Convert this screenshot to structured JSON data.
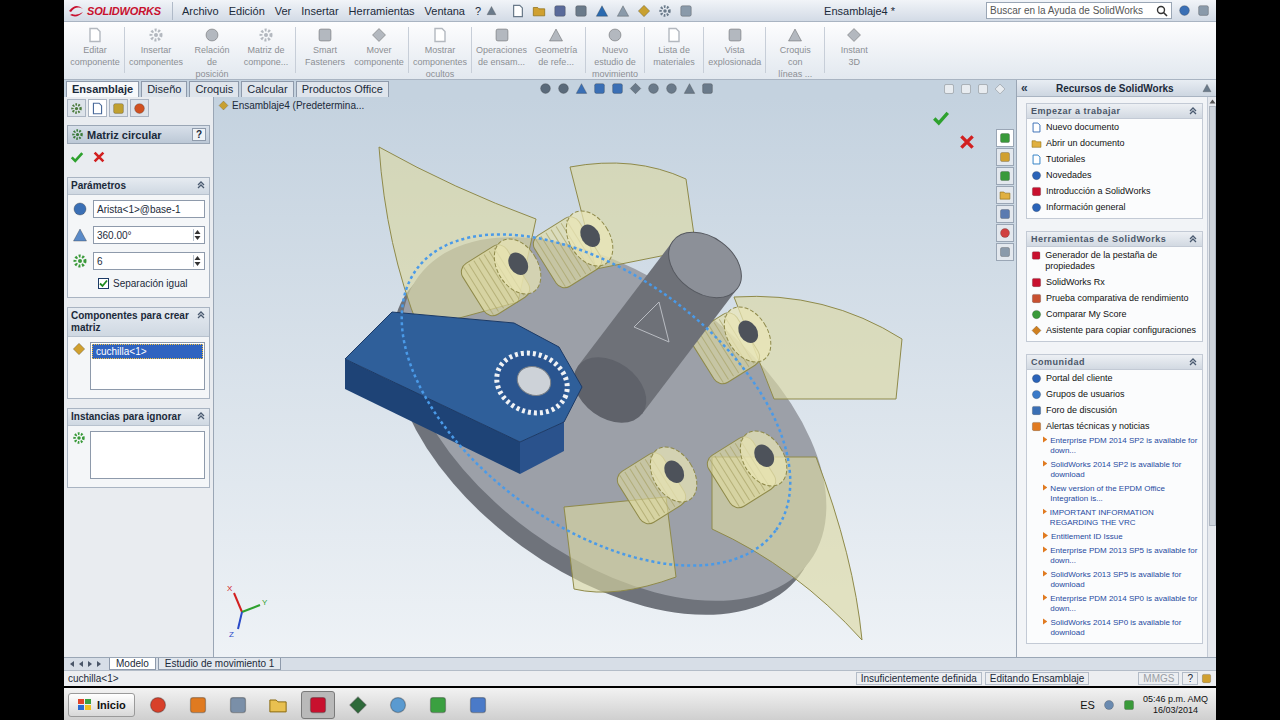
{
  "app": {
    "logo_text": "SOLIDWORKS",
    "title": "Ensamblaje4 *"
  },
  "menu": [
    "Archivo",
    "Edición",
    "Ver",
    "Insertar",
    "Herramientas",
    "Ventana",
    "?"
  ],
  "search": {
    "placeholder": "Buscar en la Ayuda de SolidWorks"
  },
  "ribbon": [
    {
      "lines": [
        "Editar",
        "componente"
      ],
      "disabled": true
    },
    {
      "lines": [
        "Insertar",
        "componentes"
      ],
      "disabled": true
    },
    {
      "lines": [
        "Relación",
        "de",
        "posición"
      ],
      "disabled": true
    },
    {
      "lines": [
        "Matriz de",
        "compone..."
      ],
      "disabled": true
    },
    {
      "lines": [
        "Smart",
        "Fasteners"
      ],
      "disabled": true
    },
    {
      "lines": [
        "Mover",
        "componente"
      ],
      "disabled": true
    },
    {
      "lines": [
        "Mostrar",
        "componentes",
        "ocultos"
      ],
      "disabled": true
    },
    {
      "lines": [
        "Operaciones",
        "de ensam..."
      ],
      "disabled": true
    },
    {
      "lines": [
        "Geometría",
        "de refe..."
      ],
      "disabled": true
    },
    {
      "lines": [
        "Nuevo",
        "estudio de",
        "movimiento"
      ],
      "disabled": true
    },
    {
      "lines": [
        "Lista de",
        "materiales"
      ],
      "disabled": true
    },
    {
      "lines": [
        "Vista",
        "explosionada"
      ],
      "disabled": true
    },
    {
      "lines": [
        "Croquis",
        "con",
        "líneas ..."
      ],
      "disabled": true
    },
    {
      "lines": [
        "Instant",
        "3D"
      ],
      "disabled": true
    }
  ],
  "tabs": [
    {
      "label": "Ensamblaje",
      "selected": true
    },
    {
      "label": "Diseño",
      "selected": false
    },
    {
      "label": "Croquis",
      "selected": false
    },
    {
      "label": "Calcular",
      "selected": false
    },
    {
      "label": "Productos Office",
      "selected": false
    }
  ],
  "property_manager": {
    "title": "Matriz circular",
    "help": "?",
    "parameters": {
      "title": "Parámetros",
      "expanded": true,
      "edge": "Arista<1>@base-1",
      "angle": "360.00°",
      "count": "6",
      "equal_spacing": {
        "label": "Separación igual",
        "checked": true
      }
    },
    "components": {
      "title": "Componentes para crear matriz",
      "expanded": true,
      "items": [
        {
          "label": "cuchilla<1>",
          "selected": true
        }
      ]
    },
    "skip": {
      "title": "Instancias para ignorar",
      "expanded": true,
      "items": []
    }
  },
  "graphics": {
    "tree_label": "Ensamblaje4 (Predetermina...",
    "triad": [
      "X",
      "Y",
      "Z"
    ]
  },
  "task_tabs": [
    {
      "selected": true
    },
    {
      "selected": false
    },
    {
      "selected": false
    },
    {
      "selected": false
    },
    {
      "selected": false
    },
    {
      "selected": false
    },
    {
      "selected": false
    }
  ],
  "task_pane": {
    "collapse": "«",
    "title": "Recursos de SolidWorks",
    "groups": [
      {
        "title": "Empezar a trabajar",
        "expanded": true,
        "items": [
          "Nuevo documento",
          "Abrir un documento",
          "Tutoriales",
          "Novedades",
          "Introducción a SolidWorks",
          "Información general"
        ],
        "news": []
      },
      {
        "title": "Herramientas de SolidWorks",
        "expanded": true,
        "items": [
          "Generador de la pestaña de propiedades",
          "SolidWorks Rx",
          "Prueba comparativa de rendimiento",
          "Comparar My Score",
          "Asistente para copiar configuraciones"
        ],
        "news": []
      },
      {
        "title": "Comunidad",
        "expanded": true,
        "items": [
          "Portal del cliente",
          "Grupos de usuarios",
          "Foro de discusión",
          "Alertas técnicas y noticias"
        ],
        "news": [
          "Enterprise PDM 2014 SP2 is available for down...",
          "SolidWorks 2014 SP2 is available for download",
          "New version of the EPDM Office Integration is...",
          "IMPORTANT INFORMATION REGARDING THE VRC",
          "Entitlement ID Issue",
          "Enterprise PDM 2013 SP5 is available for down...",
          "SolidWorks 2013 SP5 is available for download",
          "Enterprise PDM 2014 SP0 is available for down...",
          "SolidWorks 2014 SP0 is available for download"
        ]
      }
    ]
  },
  "bottom_tabs": [
    {
      "label": "Modelo",
      "selected": true
    },
    {
      "label": "Estudio de movimiento 1",
      "selected": false
    }
  ],
  "status_bar": {
    "selection": "cuchilla<1>",
    "fields": [
      {
        "label": "Insuficientemente definida",
        "disabled": false
      },
      {
        "label": "Editando Ensamblaje",
        "disabled": false
      },
      {
        "label": "MMGS",
        "disabled": true
      }
    ],
    "help": "?"
  },
  "taskbar": {
    "start": "Inicio",
    "apps": [
      {
        "selected": false
      },
      {
        "selected": false
      },
      {
        "selected": false
      },
      {
        "selected": false
      },
      {
        "selected": true
      },
      {
        "selected": false
      },
      {
        "selected": false
      },
      {
        "selected": false
      },
      {
        "selected": false
      }
    ],
    "language": "ES",
    "time": "05:46 p.m. AMQ",
    "date": "16/03/2014"
  }
}
